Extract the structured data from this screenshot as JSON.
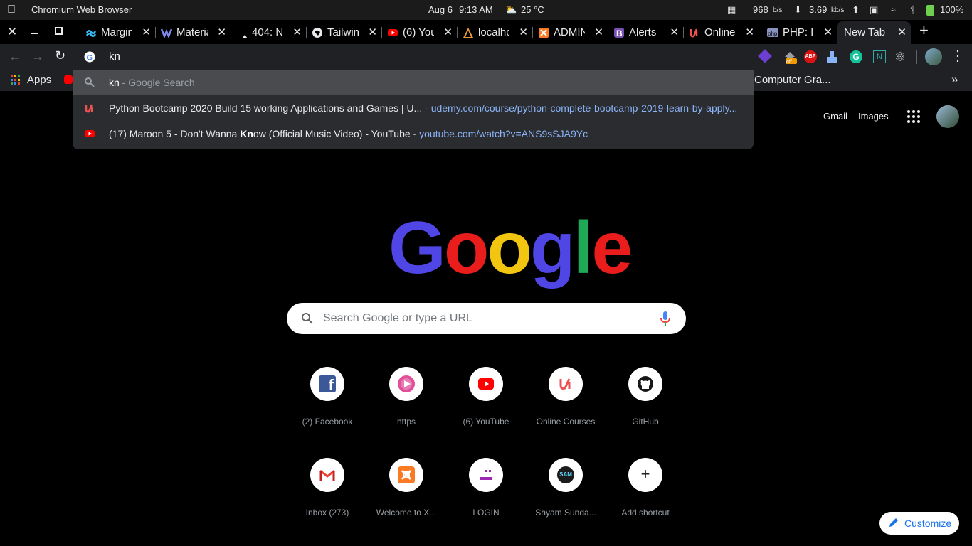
{
  "system_bar": {
    "app_name": "Chromium Web Browser",
    "date": "Aug 6",
    "time": "9:13 AM",
    "weather": "25 °C",
    "net_up": "968",
    "net_up_unit": "b/s",
    "net_down": "3.69",
    "net_down_unit": "kb/s",
    "battery": "100%"
  },
  "tabs": [
    {
      "label": "Margin",
      "icon": "tailwind-icon"
    },
    {
      "label": "Material",
      "icon": "material-icon"
    },
    {
      "label": "404: N",
      "icon": "page-icon"
    },
    {
      "label": "Tailwind",
      "icon": "globe-icon"
    },
    {
      "label": "(6) You",
      "icon": "youtube-icon"
    },
    {
      "label": "localhost",
      "icon": "xampp-icon"
    },
    {
      "label": "ADMIN",
      "icon": "xampp-icon"
    },
    {
      "label": "Alerts",
      "icon": "bootstrap-icon"
    },
    {
      "label": "Online",
      "icon": "udemy-icon"
    },
    {
      "label": "PHP: I",
      "icon": "php-icon"
    }
  ],
  "active_tab": {
    "label": "New Tab"
  },
  "omnibox": {
    "typed": "kn",
    "suggestions": [
      {
        "title": "kn",
        "suffix": " - Google Search",
        "icon": "search-icon",
        "url": ""
      },
      {
        "title": "Python Bootcamp 2020 Build 15 working Applications and Games | U...",
        "suffix": " - ",
        "icon": "udemy-icon",
        "url": "udemy.com/course/python-complete-bootcamp-2019-learn-by-apply..."
      },
      {
        "title_pre": "(17) Maroon 5 - Don't Wanna ",
        "title_bold": "Kn",
        "title_post": "ow (Official Music Video) - YouTube",
        "suffix": " - ",
        "icon": "youtube-icon",
        "url": "youtube.com/watch?v=ANS9sSJA9Yc"
      }
    ]
  },
  "bookmarks": {
    "apps_label": "Apps",
    "right_label": "Computer Gra...",
    "more_label": "»"
  },
  "header_links": {
    "gmail": "Gmail",
    "images": "Images"
  },
  "search": {
    "placeholder": "Search Google or type a URL"
  },
  "logo_text": {
    "g1": "G",
    "o1": "o",
    "o2": "o",
    "g2": "g",
    "l": "l",
    "e": "e"
  },
  "shortcuts": [
    {
      "name": "(2) Facebook",
      "icon": "facebook-icon"
    },
    {
      "name": "https",
      "icon": "play-icon"
    },
    {
      "name": "(6) YouTube",
      "icon": "youtube-icon"
    },
    {
      "name": "Online Courses",
      "icon": "udemy-icon"
    },
    {
      "name": "GitHub",
      "icon": "github-icon"
    },
    {
      "name": "Inbox (273)",
      "icon": "gmail-icon"
    },
    {
      "name": "Welcome to X...",
      "icon": "xampp-icon"
    },
    {
      "name": "LOGIN",
      "icon": "login-icon"
    },
    {
      "name": "Shyam Sunda...",
      "icon": "sam-icon"
    },
    {
      "name": "Add shortcut",
      "icon": "plus-icon"
    }
  ],
  "customize": {
    "label": "Customize"
  },
  "colors": {
    "google_blue": "#4f46e5",
    "google_red": "#ea1d1d",
    "google_yellow": "#f2c511",
    "google_green": "#1fa855",
    "link_blue": "#8ab4f8"
  }
}
